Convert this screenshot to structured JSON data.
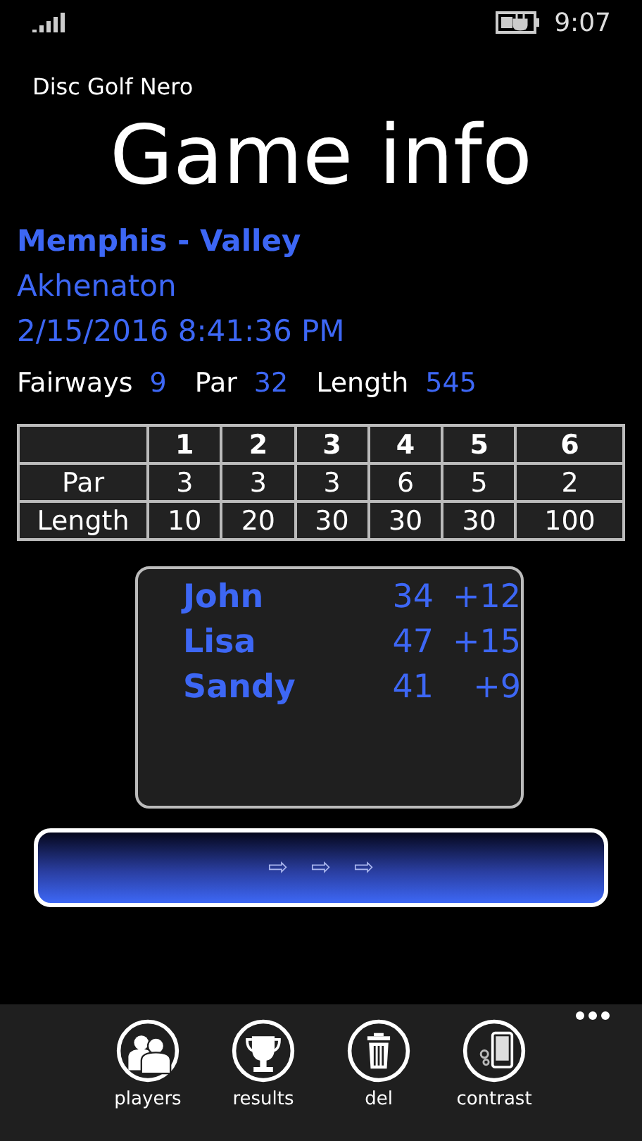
{
  "status_bar": {
    "time": "9:07"
  },
  "app_title": "Disc Golf Nero",
  "page_title": "Game info",
  "course": {
    "name": "Memphis - Valley",
    "layout": "Akhenaton",
    "date": "2/15/2016 8:41:36 PM"
  },
  "summary": [
    {
      "label": "Fairways",
      "value": "9"
    },
    {
      "label": "Par",
      "value": "32"
    },
    {
      "label": "Length",
      "value": "545"
    }
  ],
  "table": {
    "columns": [
      "1",
      "2",
      "3",
      "4",
      "5",
      "6"
    ],
    "rows": [
      {
        "label": "Par",
        "cells": [
          "3",
          "3",
          "3",
          "6",
          "5",
          "2"
        ]
      },
      {
        "label": "Length",
        "cells": [
          "10",
          "20",
          "30",
          "30",
          "30",
          "100"
        ]
      }
    ]
  },
  "players": [
    {
      "name": "John",
      "score": "34",
      "diff": "+12"
    },
    {
      "name": "Lisa",
      "score": "47",
      "diff": "+15"
    },
    {
      "name": "Sandy",
      "score": "41",
      "diff": "+9"
    }
  ],
  "next_button": {
    "label": "⇨   ⇨   ⇨"
  },
  "app_bar": {
    "buttons": [
      {
        "kind": "players",
        "label": "players"
      },
      {
        "kind": "results",
        "label": "results"
      },
      {
        "kind": "del",
        "label": "del"
      },
      {
        "kind": "contrast",
        "label": "contrast"
      }
    ]
  }
}
